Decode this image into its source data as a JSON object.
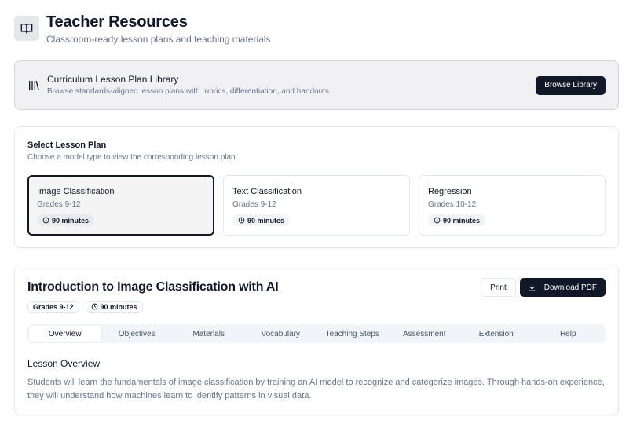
{
  "header": {
    "icon": "book-open-icon",
    "title": "Teacher Resources",
    "subtitle": "Classroom-ready lesson plans and teaching materials"
  },
  "banner": {
    "icon": "library-icon",
    "title": "Curriculum Lesson Plan Library",
    "description": "Browse standards-aligned lesson plans with rubrics, differentiation, and handouts",
    "button_label": "Browse Library"
  },
  "selector": {
    "title": "Select Lesson Plan",
    "description": "Choose a model type to view the corresponding lesson plan",
    "plans": [
      {
        "title": "Image Classification",
        "grades": "Grades 9-12",
        "duration": "90 minutes",
        "selected": true
      },
      {
        "title": "Text Classification",
        "grades": "Grades 9-12",
        "duration": "90 minutes",
        "selected": false
      },
      {
        "title": "Regression",
        "grades": "Grades 10-12",
        "duration": "90 minutes",
        "selected": false
      }
    ]
  },
  "lesson": {
    "title": "Introduction to Image Classification with AI",
    "grades": "Grades 9-12",
    "duration": "90 minutes",
    "print_label": "Print",
    "download_label": "Download PDF",
    "tabs": [
      {
        "label": "Overview",
        "active": true
      },
      {
        "label": "Objectives"
      },
      {
        "label": "Materials"
      },
      {
        "label": "Vocabulary"
      },
      {
        "label": "Teaching Steps"
      },
      {
        "label": "Assessment"
      },
      {
        "label": "Extension"
      },
      {
        "label": "Help"
      }
    ],
    "overview_title": "Lesson Overview",
    "overview_text": "Students will learn the fundamentals of image classification by training an AI model to recognize and categorize images. Through hands-on experience, they will understand how machines learn to identify patterns in visual data."
  },
  "colors": {
    "primary_dark": "#111827",
    "muted_text": "#64748b",
    "banner_bg": "#f1f1f3",
    "border": "#e2e8f0"
  }
}
